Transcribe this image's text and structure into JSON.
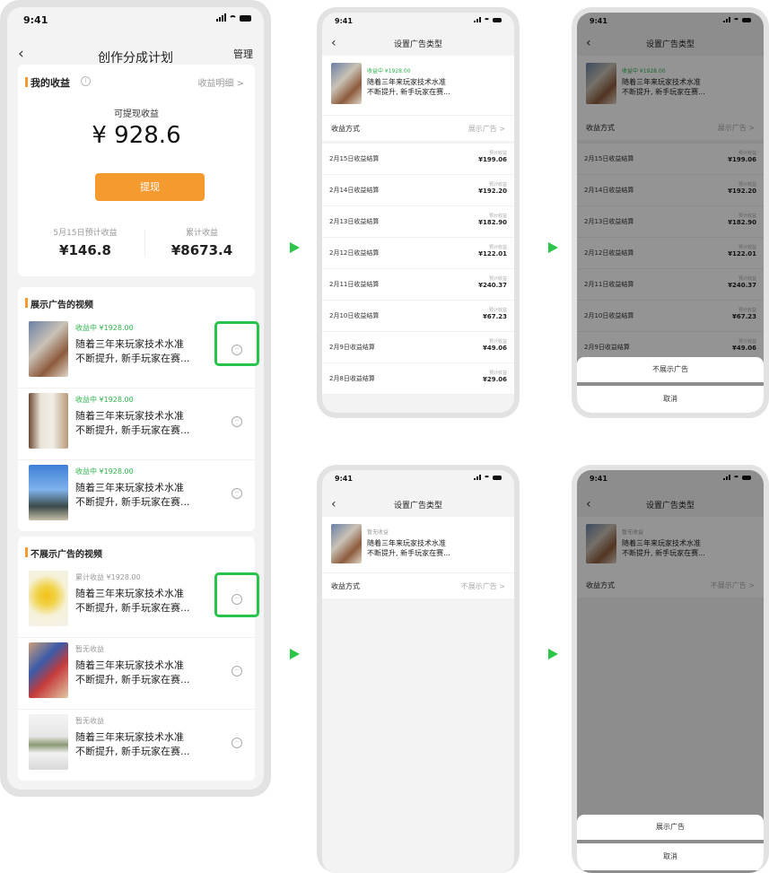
{
  "status_time": "9:41",
  "colors": {
    "accent": "#2fb24d",
    "button": "#f59a2f",
    "highlight": "#27c34a",
    "arrow": "#2bc548"
  },
  "main": {
    "title": "创作分成计划",
    "manage": "管理",
    "earnings_title": "我的收益",
    "earnings_detail": "收益明细 >",
    "withdrawable_label": "可提现收益",
    "withdrawable_value": "¥ 928.6",
    "withdraw_button": "提现",
    "forecast_label": "5月15日预计收益",
    "forecast_value": "¥146.8",
    "total_label": "累计收益",
    "total_value": "¥8673.4",
    "ad_section_title": "展示广告的视频",
    "ad_videos": [
      {
        "status": "收益中 ¥1928.00",
        "line1": "随着三年来玩家技术水准",
        "line2": "不断提升, 新手玩家在赛..."
      },
      {
        "status": "收益中 ¥1928.00",
        "line1": "随着三年来玩家技术水准",
        "line2": "不断提升, 新手玩家在赛..."
      },
      {
        "status": "收益中 ¥1928.00",
        "line1": "随着三年来玩家技术水准",
        "line2": "不断提升, 新手玩家在赛..."
      }
    ],
    "noad_section_title": "不展示广告的视频",
    "noad_videos": [
      {
        "status": "累计收益 ¥1928.00",
        "line1": "随着三年来玩家技术水准",
        "line2": "不断提升, 新手玩家在赛..."
      },
      {
        "status": "暂无收益",
        "line1": "随着三年来玩家技术水准",
        "line2": "不断提升, 新手玩家在赛..."
      },
      {
        "status": "暂无收益",
        "line1": "随着三年来玩家技术水准",
        "line2": "不断提升, 新手玩家在赛..."
      }
    ]
  },
  "settings": {
    "title": "设置广告类型",
    "video_status_earning": "收益中 ¥1928.00",
    "video_status_none": "暂无收益",
    "video_line1": "随着三年来玩家技术水准",
    "video_line2": "不断提升, 新手玩家在赛...",
    "method_label": "收益方式",
    "method_show": "展示广告 >",
    "method_hide": "不展示广告 >",
    "forecast_small": "预计收益",
    "settlements": [
      {
        "date": "2月15日收益结算",
        "amount": "¥199.06"
      },
      {
        "date": "2月14日收益结算",
        "amount": "¥192.20"
      },
      {
        "date": "2月13日收益结算",
        "amount": "¥182.90"
      },
      {
        "date": "2月12日收益结算",
        "amount": "¥122.01"
      },
      {
        "date": "2月11日收益结算",
        "amount": "¥240.37"
      },
      {
        "date": "2月10日收益结算",
        "amount": "¥67.23"
      },
      {
        "date": "2月9日收益结算",
        "amount": "¥49.06"
      },
      {
        "date": "2月8日收益结算",
        "amount": "¥29.06"
      }
    ],
    "sheet_hide": "不展示广告",
    "sheet_show": "展示广告",
    "sheet_cancel": "取消"
  }
}
